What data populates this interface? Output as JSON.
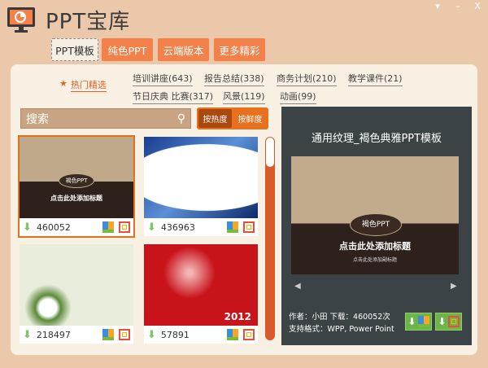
{
  "app": {
    "title": "PPT宝库",
    "window_controls": [
      "▾",
      "–",
      "X"
    ]
  },
  "tabs": [
    {
      "label": "PPT模板",
      "active": true
    },
    {
      "label": "纯色PPT"
    },
    {
      "label": "云端版本"
    },
    {
      "label": "更多精彩"
    }
  ],
  "hot": {
    "label": "热门精选",
    "icon": "star-icon"
  },
  "categories": [
    {
      "label": "培训讲座(643)"
    },
    {
      "label": "报告总结(338)"
    },
    {
      "label": "商务计划(210)"
    },
    {
      "label": "教学课件(21)"
    },
    {
      "label": "节日庆典 比赛(317)"
    },
    {
      "label": "风景(119)"
    },
    {
      "label": "动画(99)"
    }
  ],
  "search": {
    "placeholder": "搜索"
  },
  "sort": {
    "by_hot": "按热度",
    "by_new": "按鲜度",
    "active": "by_hot"
  },
  "templates": [
    {
      "downloads": "460052",
      "selected": true,
      "thumb_title": "点击此处添加标题",
      "thumb_badge": "褐色PPT"
    },
    {
      "downloads": "436963"
    },
    {
      "downloads": "218497"
    },
    {
      "downloads": "57891",
      "thumb_year": "2012"
    }
  ],
  "scroll_position": 0,
  "detail": {
    "title": "通用纹理_褐色典雅PPT模板",
    "preview_badge": "褐色PPT",
    "preview_title": "点击此处添加标题",
    "preview_subtitle": "点击此处添加副标题",
    "author_line": "作者：小田 下载：460052次",
    "formats_line": "支持格式：WPP, Power Point"
  },
  "colors": {
    "accent": "#f4814a",
    "background": "#ecc8aa",
    "panel": "#f8f0e2",
    "detail_panel": "#3c4346",
    "download": "#6cb548"
  }
}
